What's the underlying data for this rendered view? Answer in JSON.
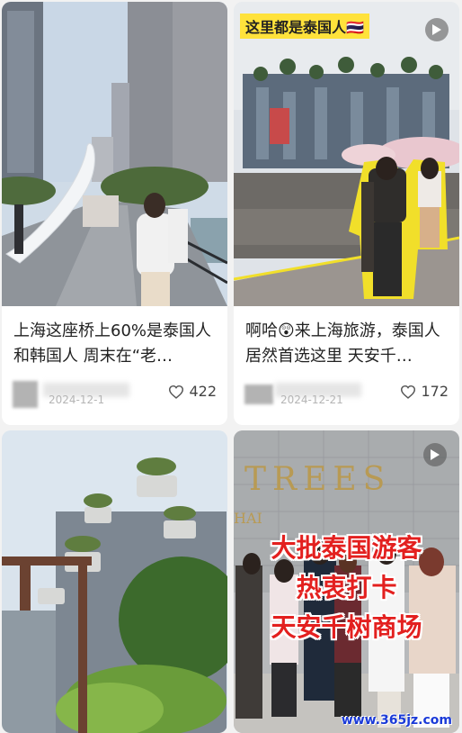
{
  "feed": {
    "cards": [
      {
        "title": "上海这座桥上60%是泰国人和韩国人 周末在“老…",
        "date": "2024-12-1",
        "likes": "422",
        "has_video": false
      },
      {
        "title": "啊哈😲来上海旅游，泰国人居然首选这里 天安千…",
        "date": "2024-12-21",
        "likes": "172",
        "has_video": true,
        "image_banner": "这里都是泰国人🇹🇭"
      },
      {
        "has_video": false
      },
      {
        "has_video": true,
        "sign_text": "TREES",
        "sign_sub": "HAI",
        "caption_lines": [
          "大批泰国游客",
          "热衷打卡",
          "天安千树商场"
        ],
        "watermark": "www.365jz.com"
      }
    ]
  },
  "icons": {
    "like": "heart-outline-icon",
    "play": "play-icon"
  },
  "colors": {
    "background": "#f2f2f2",
    "caption_red": "#e3201f",
    "banner_yellow": "#ffe23b",
    "sign_gold": "#b89a54",
    "watermark_blue": "#1a3ad8"
  }
}
